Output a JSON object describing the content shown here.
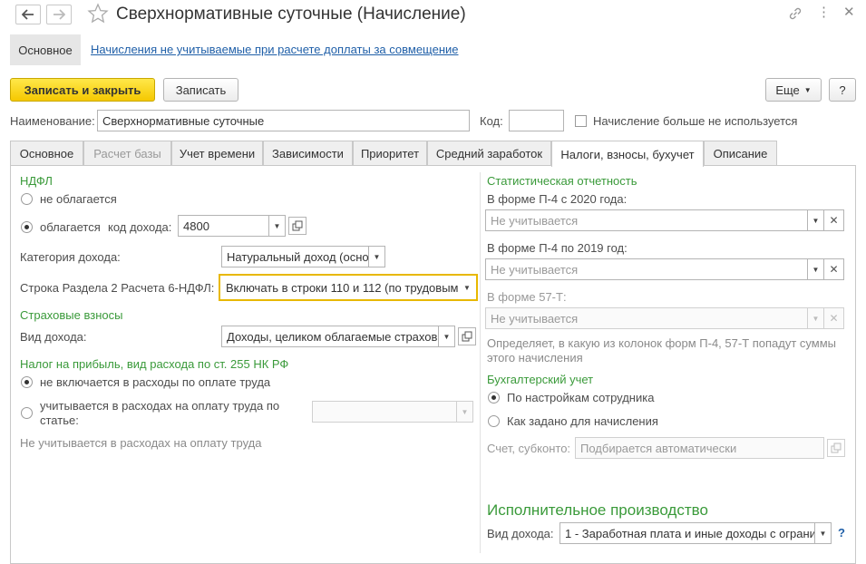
{
  "window": {
    "title": "Сверхнормативные суточные (Начисление)"
  },
  "nav_links": {
    "main": "Основное",
    "charges_link": "Начисления не учитываемые при расчете доплаты за совмещение"
  },
  "toolbar": {
    "save_close": "Записать и закрыть",
    "save": "Записать",
    "more": "Еще",
    "help": "?"
  },
  "header": {
    "name_label": "Наименование:",
    "name_value": "Сверхнормативные суточные",
    "code_label": "Код:",
    "code_value": "",
    "unused_label": "Начисление больше не используется"
  },
  "tabs": [
    {
      "label": "Основное"
    },
    {
      "label": "Расчет базы"
    },
    {
      "label": "Учет времени"
    },
    {
      "label": "Зависимости"
    },
    {
      "label": "Приоритет"
    },
    {
      "label": "Средний заработок"
    },
    {
      "label": "Налоги, взносы, бухучет"
    },
    {
      "label": "Описание"
    }
  ],
  "ndfl": {
    "heading": "НДФЛ",
    "not_taxed": "не облагается",
    "taxed": "облагается",
    "income_code_label": "код дохода:",
    "income_code_value": "4800",
    "income_category_label": "Категория дохода:",
    "income_category_value": "Натуральный доход (осно",
    "section2_label": "Строка Раздела 2 Расчета 6-НДФЛ:",
    "section2_value": "Включать в строки 110 и 112 (по трудовым"
  },
  "insurance": {
    "heading": "Страховые взносы",
    "income_type_label": "Вид дохода:",
    "income_type_value": "Доходы, целиком облагаемые страховы"
  },
  "profit_tax": {
    "heading": "Налог на прибыль, вид расхода по ст. 255 НК РФ",
    "not_included": "не включается в расходы по оплате труда",
    "included_line1": "учитывается в расходах на оплату труда по",
    "included_line2": "статье:",
    "note": "Не учитывается в расходах на оплату труда"
  },
  "stat": {
    "heading": "Статистическая отчетность",
    "p4_2020_label": "В форме П-4 с 2020 года:",
    "p4_2020_value": "Не учитывается",
    "p4_2019_label": "В форме П-4 по 2019 год:",
    "p4_2019_value": "Не учитывается",
    "f57_label": "В форме 57-Т:",
    "f57_value": "Не учитывается",
    "note_line1": "Определяет, в какую из колонок форм П-4, 57-Т попадут суммы",
    "note_line2": "этого начисления"
  },
  "accounting": {
    "heading": "Бухгалтерский учет",
    "by_employee": "По настройкам сотрудника",
    "as_set": "Как задано для начисления",
    "account_label": "Счет, субконто:",
    "account_value": "Подбирается автоматически"
  },
  "enforcement": {
    "heading": "Исполнительное производство",
    "income_type_label": "Вид дохода:",
    "income_type_value": "1 - Заработная плата и иные доходы с ограни",
    "help": "?"
  },
  "colors": {
    "accent_green": "#3a9a3a",
    "primary_yellow": "#f5c800",
    "link_blue": "#1f5fa8",
    "focus_border": "#e8b800"
  }
}
